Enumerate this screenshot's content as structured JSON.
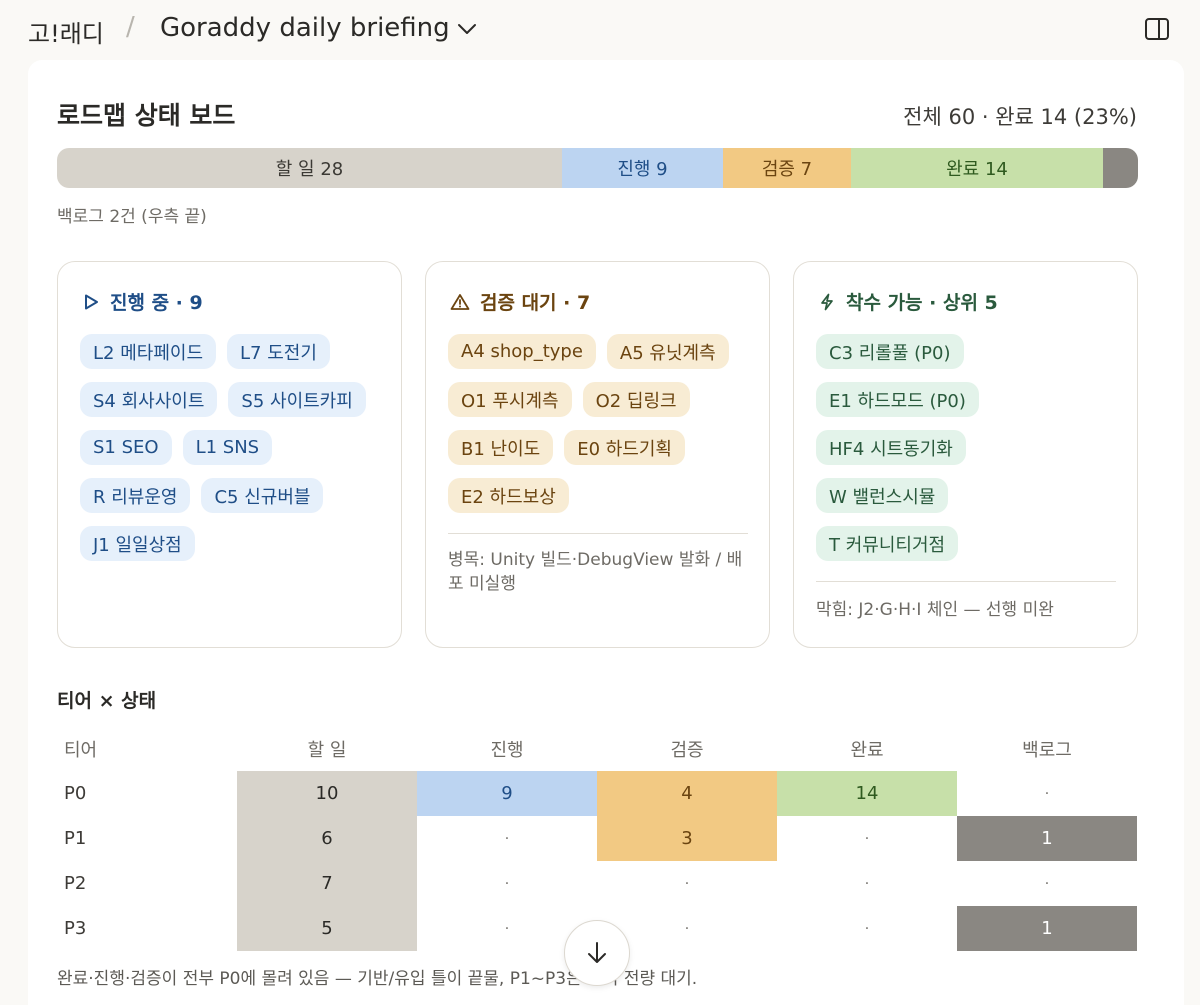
{
  "header": {
    "app_name": "고!래디",
    "separator": "/",
    "doc_title": "Goraddy daily briefing"
  },
  "board": {
    "title": "로드맵 상태 보드",
    "summary": "전체 60 · 완료 14 (23%)",
    "bar": {
      "todo_label": "할 일 28",
      "progress_label": "진행 9",
      "verify_label": "검증 7",
      "done_label": "완료 14"
    },
    "backlog_note": "백로그 2건 (우측 끝)"
  },
  "cards": {
    "in_progress": {
      "title": "진행 중 · 9",
      "chips": [
        "L2 메타페이드",
        "L7 도전기",
        "S4 회사사이트",
        "S5 사이트카피",
        "S1 SEO",
        "L1 SNS",
        "R 리뷰운영",
        "C5 신규버블",
        "J1 일일상점"
      ]
    },
    "awaiting_verify": {
      "title": "검증 대기 · 7",
      "chips": [
        "A4 shop_type",
        "A5 유닛계측",
        "O1 푸시계측",
        "O2 딥링크",
        "B1 난이도",
        "E0 하드기획",
        "E2 하드보상"
      ],
      "note": "병목: Unity 빌드·DebugView 발화 / 배포 미실행"
    },
    "ready_to_start": {
      "title": "착수 가능 · 상위 5",
      "chips": [
        "C3 리롤풀 (P0)",
        "E1 하드모드 (P0)",
        "HF4 시트동기화",
        "W 밸런스시뮬",
        "T 커뮤니티거점"
      ],
      "note": "막힘: J2·G·H·I 체인 — 선행 미완"
    }
  },
  "tier": {
    "title": "티어 × 상태",
    "headers": [
      "티어",
      "할 일",
      "진행",
      "검증",
      "완료",
      "백로그"
    ],
    "rows": [
      {
        "tier": "P0",
        "todo": "10",
        "progress": "9",
        "verify": "4",
        "done": "14",
        "backlog": "·"
      },
      {
        "tier": "P1",
        "todo": "6",
        "progress": "·",
        "verify": "3",
        "done": "·",
        "backlog": "1"
      },
      {
        "tier": "P2",
        "todo": "7",
        "progress": "·",
        "verify": "·",
        "done": "·",
        "backlog": "·"
      },
      {
        "tier": "P3",
        "todo": "5",
        "progress": "·",
        "verify": "·",
        "done": "·",
        "backlog": "1"
      }
    ],
    "footnote": "완료·진행·검증이 전부 P0에 몰려 있음 — 기반/유입 틀이 끝물, P1~P3은 아직 전량 대기."
  },
  "icons": {
    "doc_menu": "chevron-down-icon",
    "sidebar_toggle": "sidebar-toggle-icon",
    "in_progress": "play-triangle-icon",
    "awaiting_verify": "warning-icon",
    "ready_to_start": "lightning-icon",
    "scroll": "arrow-down-icon"
  },
  "colors": {
    "todo": "#d7d3cb",
    "progress": "#bcd4f1",
    "verify": "#f2c983",
    "done": "#c7e0a9",
    "backlog": "#8a8782"
  }
}
